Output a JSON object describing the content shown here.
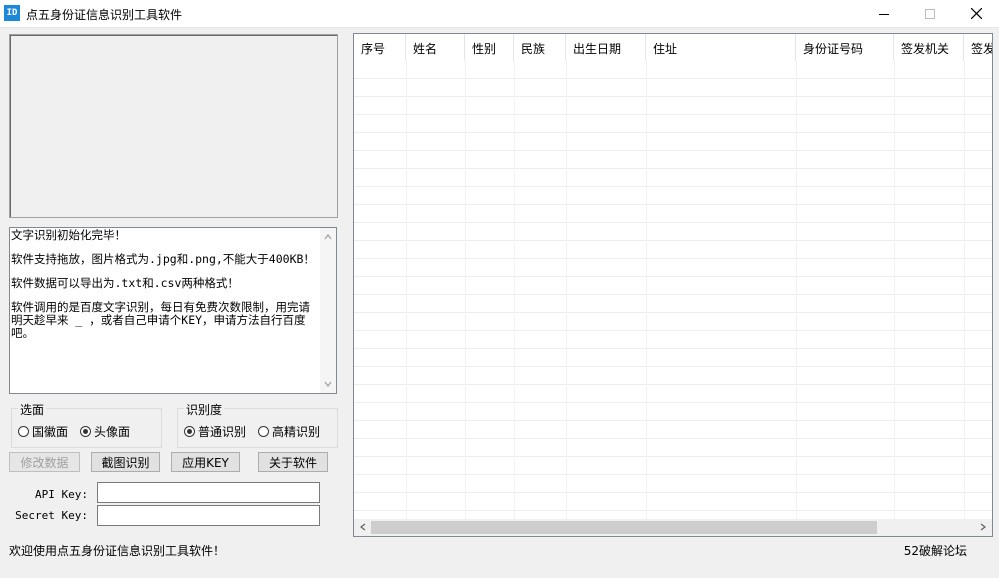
{
  "window": {
    "icon_text": "ID",
    "title": "点五身份证信息识别工具软件"
  },
  "log": {
    "lines": [
      "文字识别初始化完毕！",
      "软件支持拖放，图片格式为.jpg和.png,不能大于400KB！",
      "软件数据可以导出为.txt和.csv两种格式！",
      "软件调用的是百度文字识别，每日有免费次数限制，用完请明天趁早来 _ ，或者自己申请个KEY，申请方法自行百度吧。"
    ]
  },
  "side_group": {
    "label": "选面",
    "options": [
      {
        "label": "国徽面",
        "selected": false
      },
      {
        "label": "头像面",
        "selected": true
      }
    ]
  },
  "accuracy_group": {
    "label": "识别度",
    "options": [
      {
        "label": "普通识别",
        "selected": true
      },
      {
        "label": "高精识别",
        "selected": false
      }
    ]
  },
  "buttons": {
    "modify": "修改数据",
    "capture": "截图识别",
    "apply_key": "应用KEY",
    "about": "关于软件"
  },
  "fields": {
    "api_key_label": "API Key:",
    "api_key_value": "",
    "secret_key_label": "Secret Key:",
    "secret_key_value": ""
  },
  "table": {
    "columns": [
      "序号",
      "姓名",
      "性别",
      "民族",
      "出生日期",
      "住址",
      "身份证号码",
      "签发机关",
      "签发"
    ],
    "rows": []
  },
  "status": {
    "left": "欢迎使用点五身份证信息识别工具软件！",
    "right": "52破解论坛"
  }
}
